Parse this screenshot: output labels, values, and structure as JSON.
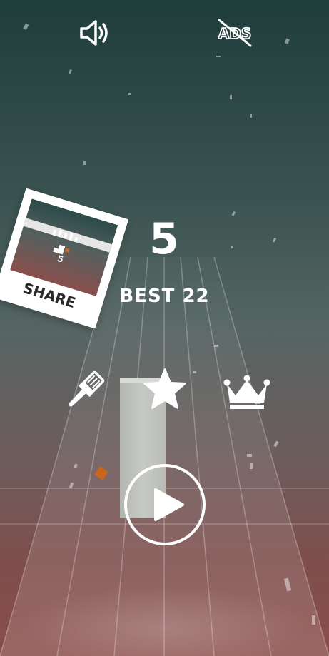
{
  "top_bar": {
    "sound_icon": "speaker-icon",
    "no_ads_icon": "no-ads-icon",
    "no_ads_text": "ADS"
  },
  "game": {
    "score": "5",
    "best": "BEST 22"
  },
  "share": {
    "label": "SHARE",
    "thumbnail_score": "5"
  },
  "menu": {
    "skins_icon": "paintbrush-icon",
    "rate_icon": "star-icon",
    "leaderboard_icon": "crown-icon",
    "play_icon": "play-icon"
  },
  "colors": {
    "top": "#1f3d3b",
    "bottom": "#8a4d4a",
    "text": "#ffffff",
    "block": "#c4c6c2",
    "accent": "#c9661c"
  }
}
